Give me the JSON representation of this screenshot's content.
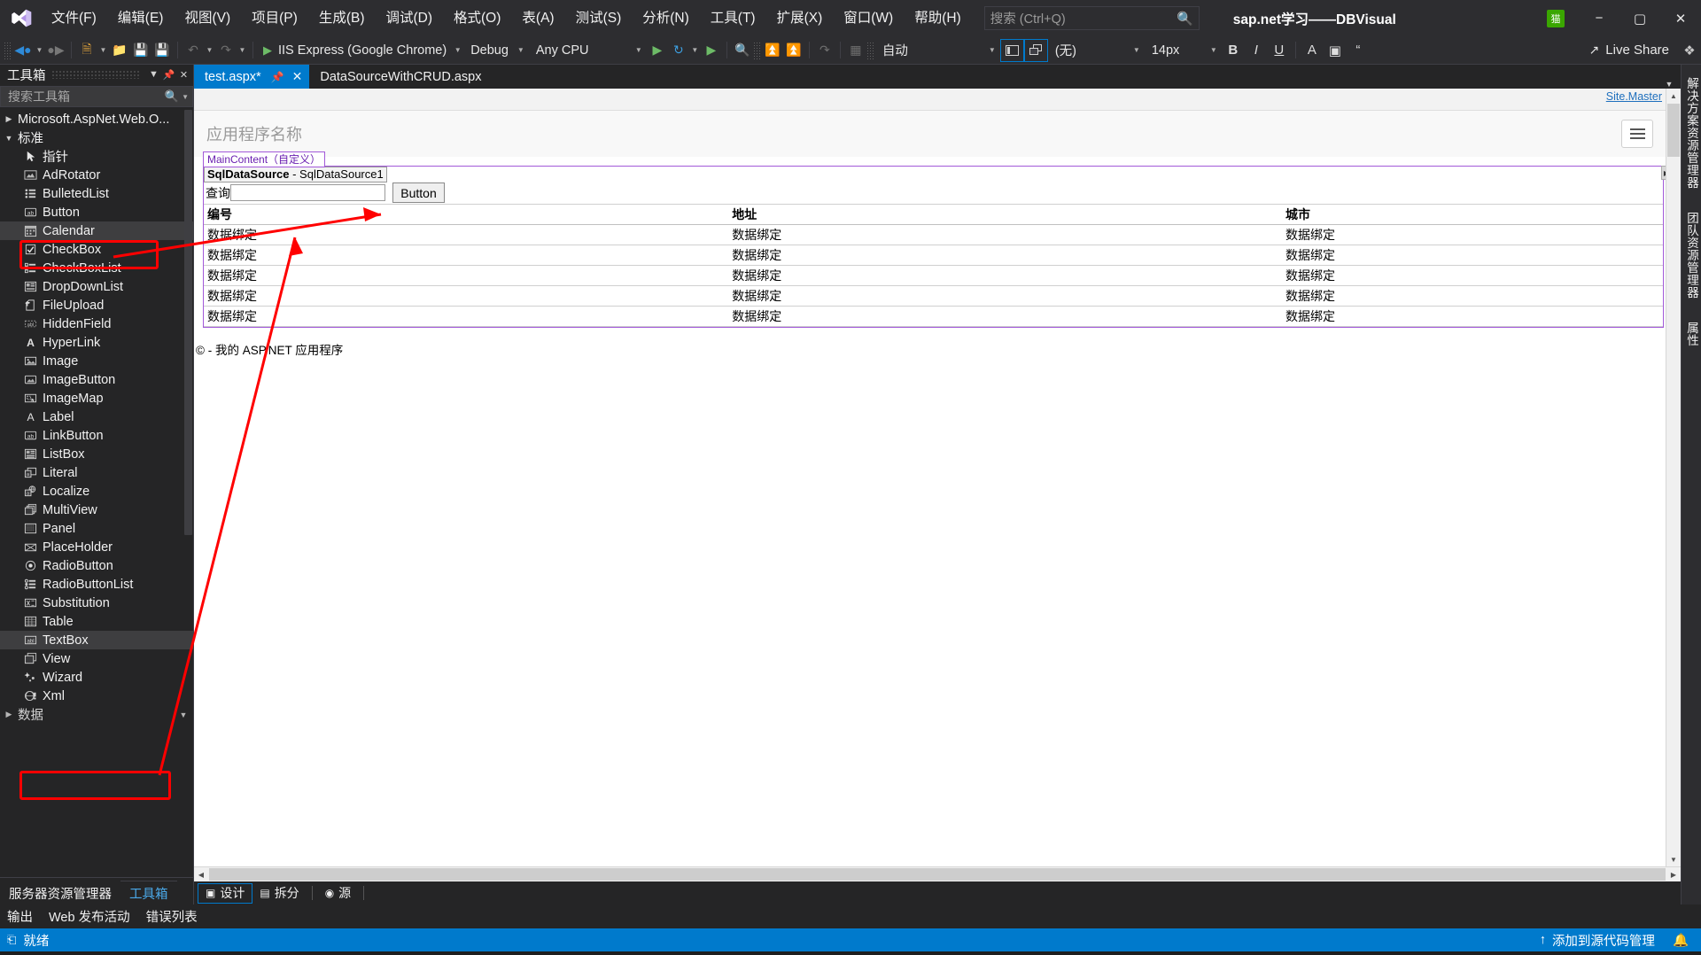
{
  "window": {
    "solution_title": "sap.net学习——DBVisual",
    "logo": "visual-studio-logo",
    "minimize": "−",
    "maximize": "▢",
    "close": "✕",
    "badge": "猫"
  },
  "menu": {
    "items": [
      {
        "label": "文件(F)"
      },
      {
        "label": "编辑(E)"
      },
      {
        "label": "视图(V)"
      },
      {
        "label": "项目(P)"
      },
      {
        "label": "生成(B)"
      },
      {
        "label": "调试(D)"
      },
      {
        "label": "格式(O)"
      },
      {
        "label": "表(A)"
      },
      {
        "label": "测试(S)"
      },
      {
        "label": "分析(N)"
      },
      {
        "label": "工具(T)"
      },
      {
        "label": "扩展(X)"
      },
      {
        "label": "窗口(W)"
      },
      {
        "label": "帮助(H)"
      }
    ],
    "search_placeholder": "搜索 (Ctrl+Q)",
    "search_icon": "search-icon"
  },
  "toolbar": {
    "run_target": "IIS Express (Google Chrome)",
    "configuration": "Debug",
    "platform": "Any CPU",
    "style_target": "自动",
    "css_class": "(无)",
    "font_size": "14px",
    "bold": "B",
    "italic": "I",
    "underline": "U",
    "foreground": "A",
    "live_share": "Live Share"
  },
  "toolbox": {
    "title": "工具箱",
    "search_placeholder": "搜索工具箱",
    "groups": [
      {
        "label": "Microsoft.AspNet.Web.O...",
        "expanded": false
      },
      {
        "label": "标准",
        "expanded": true
      }
    ],
    "items": [
      {
        "label": "指针",
        "icon": "pointer-icon"
      },
      {
        "label": "AdRotator",
        "icon": "adrotator-icon"
      },
      {
        "label": "BulletedList",
        "icon": "bulletedlist-icon"
      },
      {
        "label": "Button",
        "icon": "button-icon"
      },
      {
        "label": "Calendar",
        "icon": "calendar-icon"
      },
      {
        "label": "CheckBox",
        "icon": "checkbox-icon"
      },
      {
        "label": "CheckBoxList",
        "icon": "checkboxlist-icon"
      },
      {
        "label": "DropDownList",
        "icon": "dropdownlist-icon"
      },
      {
        "label": "FileUpload",
        "icon": "fileupload-icon"
      },
      {
        "label": "HiddenField",
        "icon": "hiddenfield-icon"
      },
      {
        "label": "HyperLink",
        "icon": "hyperlink-icon"
      },
      {
        "label": "Image",
        "icon": "image-icon"
      },
      {
        "label": "ImageButton",
        "icon": "imagebutton-icon"
      },
      {
        "label": "ImageMap",
        "icon": "imagemap-icon"
      },
      {
        "label": "Label",
        "icon": "label-icon"
      },
      {
        "label": "LinkButton",
        "icon": "linkbutton-icon"
      },
      {
        "label": "ListBox",
        "icon": "listbox-icon"
      },
      {
        "label": "Literal",
        "icon": "literal-icon"
      },
      {
        "label": "Localize",
        "icon": "localize-icon"
      },
      {
        "label": "MultiView",
        "icon": "multiview-icon"
      },
      {
        "label": "Panel",
        "icon": "panel-icon"
      },
      {
        "label": "PlaceHolder",
        "icon": "placeholder-icon"
      },
      {
        "label": "RadioButton",
        "icon": "radiobutton-icon"
      },
      {
        "label": "RadioButtonList",
        "icon": "radiobuttonlist-icon"
      },
      {
        "label": "Substitution",
        "icon": "substitution-icon"
      },
      {
        "label": "Table",
        "icon": "table-icon"
      },
      {
        "label": "TextBox",
        "icon": "textbox-icon"
      },
      {
        "label": "View",
        "icon": "view-icon"
      },
      {
        "label": "Wizard",
        "icon": "wizard-icon"
      },
      {
        "label": "Xml",
        "icon": "xml-icon"
      }
    ],
    "next_group": "数据",
    "dock_tabs": [
      {
        "label": "服务器资源管理器",
        "active": false
      },
      {
        "label": "工具箱",
        "active": true
      }
    ]
  },
  "editor": {
    "tabs": [
      {
        "label": "test.aspx*",
        "active": true
      },
      {
        "label": "DataSourceWithCRUD.aspx",
        "active": false
      }
    ],
    "site_master_link": "Site.Master",
    "designer": {
      "app_name": "应用程序名称",
      "region_tag": "MainContent（自定义）",
      "datasource_prefix": "SqlDataSource",
      "datasource_name": "SqlDataSource1",
      "datasource_separator": " - ",
      "query_label": "查询",
      "query_value": "",
      "button_label": "Button",
      "grid_headers": [
        "编号",
        "地址",
        "城市"
      ],
      "grid_rows": [
        [
          "数据绑定",
          "数据绑定",
          "数据绑定"
        ],
        [
          "数据绑定",
          "数据绑定",
          "数据绑定"
        ],
        [
          "数据绑定",
          "数据绑定",
          "数据绑定"
        ],
        [
          "数据绑定",
          "数据绑定",
          "数据绑定"
        ],
        [
          "数据绑定",
          "数据绑定",
          "数据绑定"
        ]
      ],
      "copyright": "© - 我的 ASP.NET 应用程序"
    },
    "view_tabs": [
      {
        "label": "设计",
        "active": true,
        "icon": "design-view-icon"
      },
      {
        "label": "拆分",
        "active": false,
        "icon": "split-view-icon"
      },
      {
        "label": "源",
        "active": false,
        "icon": "source-view-icon"
      }
    ]
  },
  "right_rail": {
    "tabs": [
      "解决方案资源管理器",
      "团队资源管理器",
      "属性"
    ]
  },
  "bottom_dock": {
    "tabs": [
      "输出",
      "Web 发布活动",
      "错误列表"
    ]
  },
  "status_bar": {
    "state": "就绪",
    "state_icon": "ready-icon",
    "source_control": "添加到源代码管理",
    "source_control_icon": "upload-icon",
    "notify_icon": "bell-icon"
  },
  "annotations": {
    "accent_red": "#ff0000",
    "highlight_items": [
      "Button",
      "TextBox"
    ]
  }
}
